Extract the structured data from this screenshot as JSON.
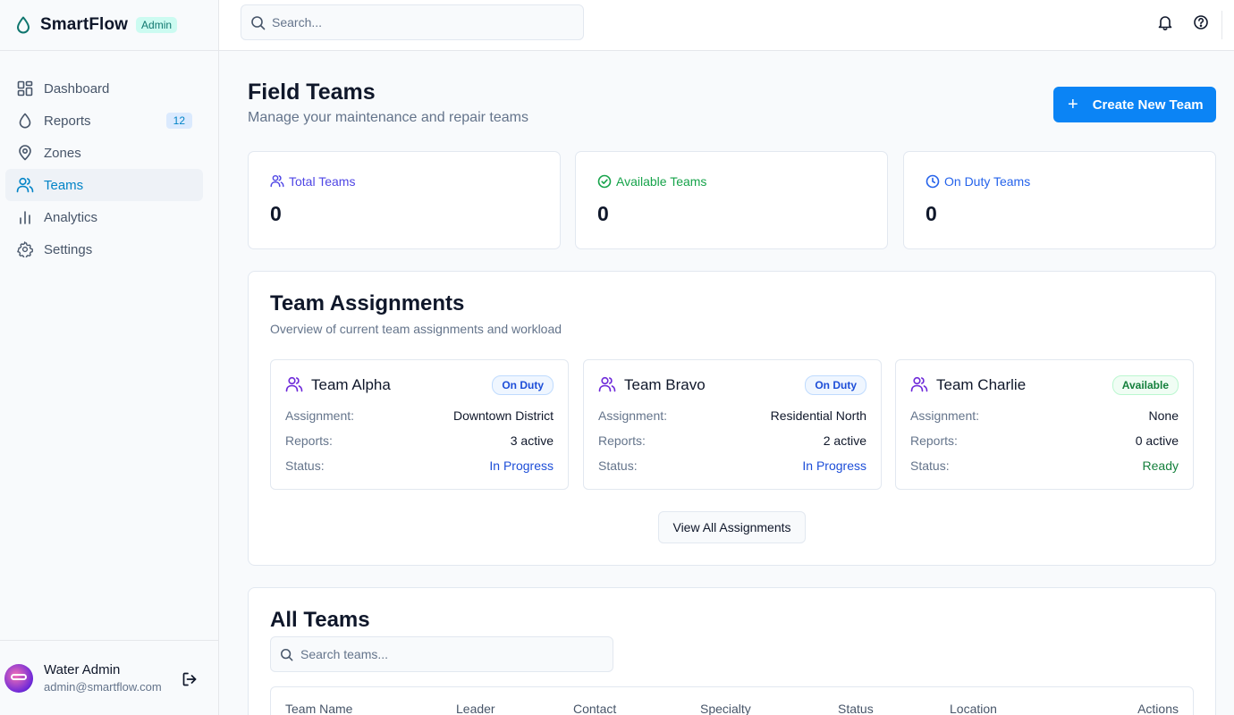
{
  "brand": {
    "name": "SmartFlow",
    "badge": "Admin"
  },
  "sidebar": {
    "items": [
      {
        "label": "Dashboard",
        "icon": "layout-grid-icon"
      },
      {
        "label": "Reports",
        "icon": "droplet-icon",
        "count": "12"
      },
      {
        "label": "Zones",
        "icon": "map-pin-icon"
      },
      {
        "label": "Teams",
        "icon": "users-icon",
        "active": true
      },
      {
        "label": "Analytics",
        "icon": "bar-chart-icon"
      },
      {
        "label": "Settings",
        "icon": "gear-icon"
      }
    ]
  },
  "user": {
    "name": "Water Admin",
    "email": "admin@smartflow.com"
  },
  "search": {
    "placeholder": "Search..."
  },
  "page": {
    "title": "Field Teams",
    "subtitle": "Manage your maintenance and repair teams",
    "create_label": "Create New Team"
  },
  "stats": [
    {
      "label": "Total Teams",
      "value": "0",
      "color": "#4f46e5"
    },
    {
      "label": "Available Teams",
      "value": "0",
      "color": "#16a34a"
    },
    {
      "label": "On Duty Teams",
      "value": "0",
      "color": "#2563eb"
    }
  ],
  "assignments": {
    "title": "Team Assignments",
    "subtitle": "Overview of current team assignments and workload",
    "labels": {
      "assignment": "Assignment:",
      "reports": "Reports:",
      "status": "Status:"
    },
    "teams": [
      {
        "name": "Team Alpha",
        "badge": "On Duty",
        "assignment": "Downtown District",
        "reports": "3 active",
        "status": "In Progress"
      },
      {
        "name": "Team Bravo",
        "badge": "On Duty",
        "assignment": "Residential North",
        "reports": "2 active",
        "status": "In Progress"
      },
      {
        "name": "Team Charlie",
        "badge": "Available",
        "assignment": "None",
        "reports": "0 active",
        "status": "Ready"
      }
    ],
    "view_all_label": "View All Assignments"
  },
  "all_teams": {
    "title": "All Teams",
    "search_placeholder": "Search teams...",
    "columns": [
      "Team Name",
      "Leader",
      "Contact",
      "Specialty",
      "Status",
      "Location",
      "Actions"
    ]
  }
}
